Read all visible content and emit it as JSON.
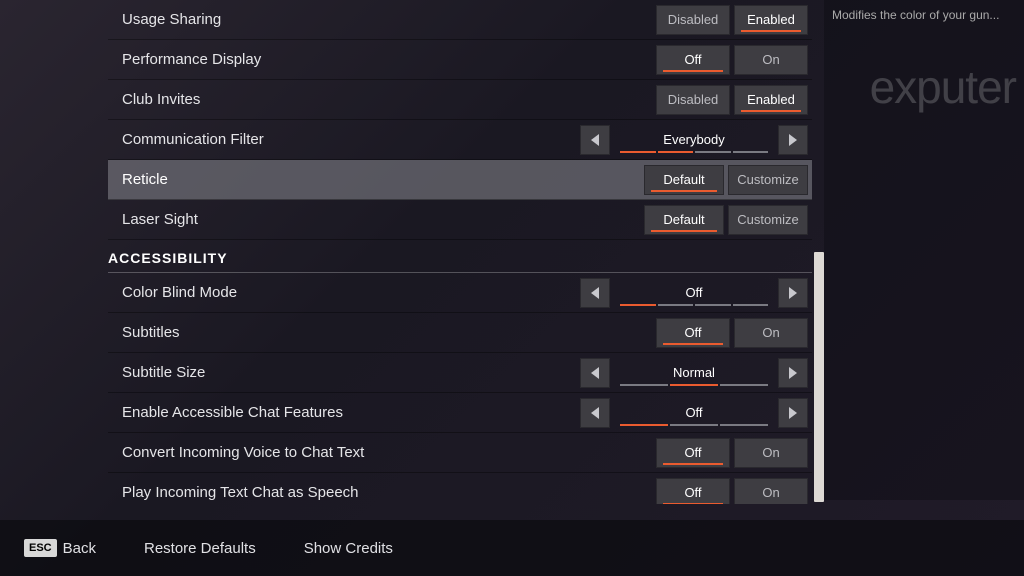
{
  "tooltip": "Modifies the color of your gun...",
  "watermark": "exputer",
  "rows": [
    {
      "label": "Usage Sharing",
      "type": "toggle2",
      "opts": [
        "Disabled",
        "Enabled"
      ],
      "active": 1,
      "highlight": false
    },
    {
      "label": "Performance Display",
      "type": "toggle2",
      "opts": [
        "Off",
        "On"
      ],
      "active": 0,
      "highlight": false
    },
    {
      "label": "Club Invites",
      "type": "toggle2",
      "opts": [
        "Disabled",
        "Enabled"
      ],
      "active": 1,
      "highlight": false
    },
    {
      "label": "Communication Filter",
      "type": "selector",
      "value": "Everybody",
      "ticks": [
        1,
        1,
        0,
        0
      ],
      "highlight": false
    },
    {
      "label": "Reticle",
      "type": "custom",
      "opts": [
        "Default",
        "Customize"
      ],
      "active": 0,
      "highlight": true
    },
    {
      "label": "Laser Sight",
      "type": "custom",
      "opts": [
        "Default",
        "Customize"
      ],
      "active": 0,
      "highlight": false
    }
  ],
  "section_header": "ACCESSIBILITY",
  "rows2": [
    {
      "label": "Color Blind Mode",
      "type": "selector",
      "value": "Off",
      "ticks": [
        1,
        0,
        0,
        0
      ],
      "highlight": false
    },
    {
      "label": "Subtitles",
      "type": "toggle2",
      "opts": [
        "Off",
        "On"
      ],
      "active": 0,
      "highlight": false
    },
    {
      "label": "Subtitle Size",
      "type": "selector",
      "value": "Normal",
      "ticks": [
        0,
        1,
        0
      ],
      "highlight": false
    },
    {
      "label": "Enable Accessible Chat Features",
      "type": "selector",
      "value": "Off",
      "ticks": [
        1,
        0,
        0
      ],
      "highlight": false
    },
    {
      "label": "Convert Incoming Voice to Chat Text",
      "type": "toggle2",
      "opts": [
        "Off",
        "On"
      ],
      "active": 0,
      "highlight": false
    },
    {
      "label": "Play Incoming Text Chat as Speech",
      "type": "toggle2",
      "opts": [
        "Off",
        "On"
      ],
      "active": 0,
      "highlight": false
    }
  ],
  "bottom": {
    "esc": "ESC",
    "back": "Back",
    "restore": "Restore Defaults",
    "credits": "Show Credits"
  }
}
